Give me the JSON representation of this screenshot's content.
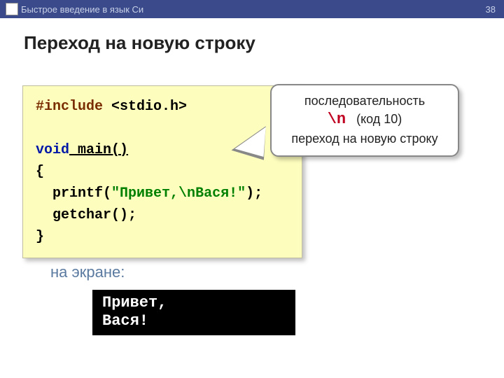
{
  "header": {
    "breadcrumb": "Быстрое введение в язык Си",
    "page_number": "38"
  },
  "title": "Переход на новую строку",
  "code": {
    "include_kw": "#include",
    "include_arg": " <stdio.h>",
    "void_kw": "void",
    "main_sig": " main()",
    "brace_open": "{",
    "printf_call": "  printf(",
    "str_part1": "\"Привет,",
    "str_escape": "\\n",
    "str_part2": "Вася!\"",
    "printf_end": ");",
    "getchar_line": "  getchar();",
    "brace_close": "}"
  },
  "balloon": {
    "line1": "последовательность",
    "escape": "\\n",
    "code_note": "   (код 10)",
    "line3": "переход на новую строку"
  },
  "onscreen_label": "на экране:",
  "console_output": "Привет,\nВася!"
}
